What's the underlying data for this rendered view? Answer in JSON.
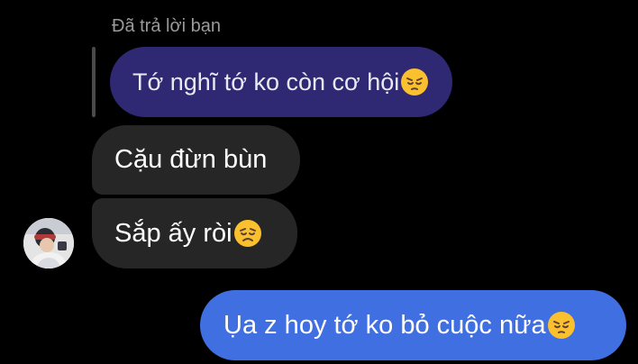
{
  "reply_header": {
    "label": "Đã trả lời bạn"
  },
  "messages": [
    {
      "text": "Tớ nghĩ tớ ko còn cơ hội",
      "emoji": "pensive-face-icon"
    },
    {
      "text": "Cặu đừn bùn"
    },
    {
      "text": "Sắp ấy ròi",
      "emoji": "disappointed-face-icon"
    },
    {
      "text": "Ụa z hoy tớ ko bỏ cuộc nữa",
      "emoji": "pensive-face-icon"
    }
  ],
  "colors": {
    "background": "#000000",
    "quoted_bubble": "#2f2873",
    "incoming_bubble": "#262626",
    "outgoing_bubble": "#3f6fe0",
    "reply_label": "#9a9a9a"
  }
}
